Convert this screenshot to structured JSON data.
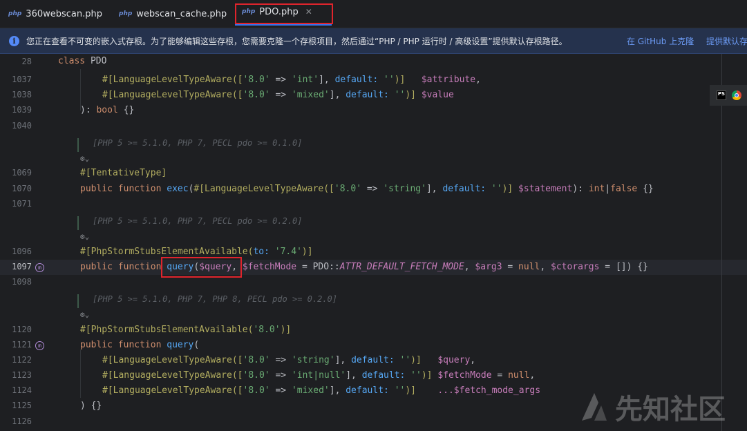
{
  "tabs": [
    {
      "icon": "php",
      "label": "360webscan.php",
      "active": false
    },
    {
      "icon": "php",
      "label": "webscan_cache.php",
      "active": false
    },
    {
      "icon": "php",
      "label": "PDO.php",
      "active": true
    }
  ],
  "banner": {
    "message": "您正在查看不可变的嵌入式存根。为了能够编辑这些存根，您需要克隆一个存根项目，然后通过“PHP / PHP 运行时 / 高级设置”提供默认存根路径。",
    "link1": "在 GitHub 上克隆",
    "link2": "提供默认存根"
  },
  "gutter": {
    "lines": [
      "28",
      "1037",
      "1038",
      "1039",
      "1040",
      "",
      "",
      "1069",
      "1070",
      "1071",
      "",
      "",
      "1096",
      "1097",
      "1098",
      "",
      "",
      "1120",
      "1121",
      "1122",
      "1123",
      "1124",
      "1125",
      "1126"
    ]
  },
  "code": {
    "class_kw": "class",
    "class_name": "PDO",
    "attr_lang": "#[LanguageLevelTypeAware([",
    "v80": "'8.0'",
    "arrow": " => ",
    "s_int": "'int'",
    "s_mixed": "'mixed'",
    "s_string": "'string'",
    "s_intnull": "'int|null'",
    "default_named": "default:",
    "empty_str": "''",
    "close_attr": ")]",
    "var_attribute": "$attribute",
    "var_value": "$value",
    "bool_kw": "bool",
    "tentative": "#[TentativeType]",
    "public_kw": "public",
    "function_kw": "function",
    "fn_exec": "exec",
    "var_statement": "$statement",
    "ret_int": "int",
    "ret_false": "false",
    "stub_avail_open": "#[PhpStormStubsElementAvailable(",
    "to_named": "to:",
    "s_74": "'7.4'",
    "s_80_plain": "'8.0'",
    "fn_query": "query",
    "var_query": "$query",
    "var_fetchMode": "$fetchMode",
    "pdo_const_class": "PDO",
    "pdo_const": "ATTR_DEFAULT_FETCH_MODE",
    "var_arg3": "$arg3",
    "null_kw": "null",
    "var_ctorargs": "$ctorargs",
    "var_fetch_mode_args": "...$fetch_mode_args",
    "fold1": "[PHP 5 >= 5.1.0, PHP 7, PECL pdo >= 0.1.0]",
    "fold2": "[PHP 5 >= 5.1.0, PHP 7, PECL pdo >= 0.2.0]",
    "fold3": "[PHP 5 >= 5.1.0, PHP 7, PHP 8, PECL pdo >= 0.2.0]"
  },
  "watermark": {
    "text": "先知社区"
  },
  "colors": {
    "accent": "#3574f0",
    "highlight_box": "#e0242c",
    "banner_bg": "#25324d"
  }
}
